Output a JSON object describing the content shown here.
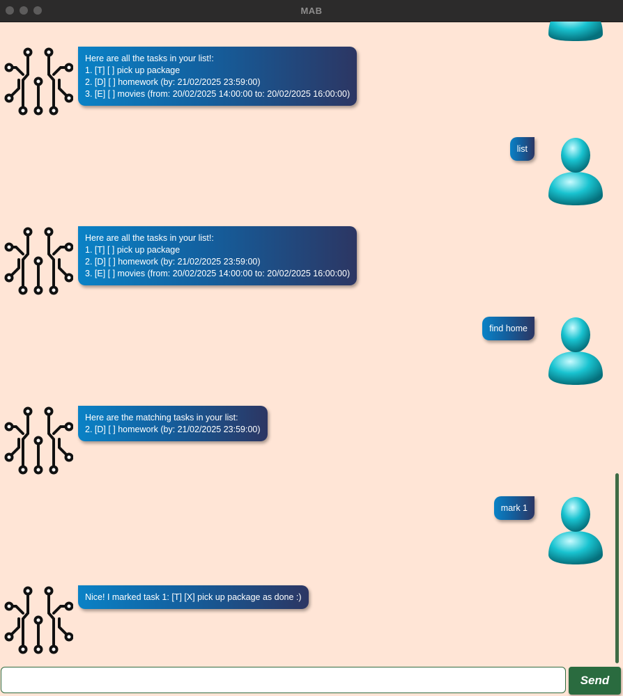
{
  "window": {
    "title": "MAB"
  },
  "messages": [
    {
      "sender": "bot",
      "lines": [
        "Here are all the tasks in your list!:",
        "1. [T] [ ] pick up package",
        "2. [D] [ ] homework  (by: 21/02/2025 23:59:00)",
        "3. [E] [ ] movies  (from: 20/02/2025 14:00:00 to: 20/02/2025 16:00:00)"
      ]
    },
    {
      "sender": "user",
      "lines": [
        "list"
      ]
    },
    {
      "sender": "bot",
      "lines": [
        "Here are all the tasks in your list!:",
        "1. [T] [ ] pick up package",
        "2. [D] [ ] homework  (by: 21/02/2025 23:59:00)",
        "3. [E] [ ] movies  (from: 20/02/2025 14:00:00 to: 20/02/2025 16:00:00)"
      ]
    },
    {
      "sender": "user",
      "lines": [
        "find home"
      ]
    },
    {
      "sender": "bot",
      "lines": [
        "Here are the matching tasks in your list:",
        "2. [D] [ ] homework  (by: 21/02/2025 23:59:00)"
      ]
    },
    {
      "sender": "user",
      "lines": [
        "mark 1"
      ]
    },
    {
      "sender": "bot",
      "lines": [
        "Nice! I marked task 1: [T] [X] pick up package as done :)"
      ]
    }
  ],
  "input": {
    "value": "",
    "placeholder": ""
  },
  "send_label": "Send",
  "colors": {
    "background": "#ffe5d6",
    "bubble_start": "#0a82c6",
    "bubble_end": "#2c3663",
    "send_button": "#2a6b3f",
    "user_avatar": "#19c3d0"
  },
  "icons": {
    "bot_avatar": "circuit-icon",
    "user_avatar": "person-icon"
  }
}
